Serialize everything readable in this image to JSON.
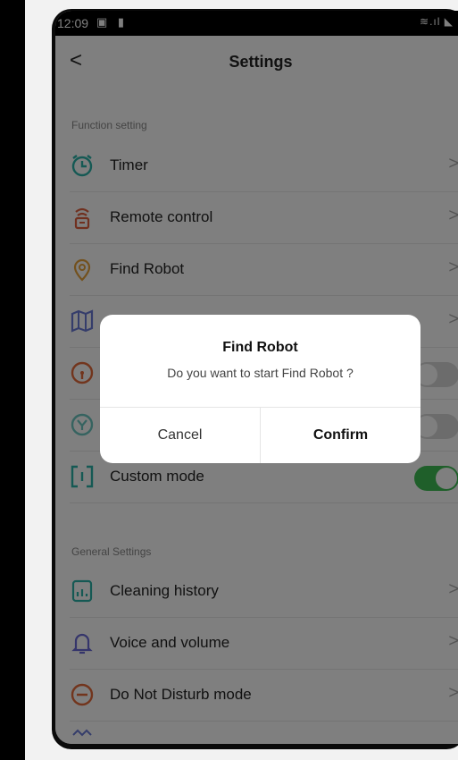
{
  "status_bar": {
    "time": "12:09",
    "left_icons": "▣ ▮",
    "signal": "≋.ıl ◣"
  },
  "header": {
    "back_glyph": "<",
    "title": "Settings"
  },
  "sections": {
    "function_label": "Function setting",
    "general_label": "General Settings"
  },
  "rows": {
    "timer": {
      "label": "Timer",
      "icon": "alarm-clock-icon",
      "color": "#2bb3a8"
    },
    "remote": {
      "label": "Remote control",
      "icon": "remote-control-icon",
      "color": "#e0603f"
    },
    "find": {
      "label": "Find Robot",
      "icon": "location-pin-icon",
      "color": "#e7a23a"
    },
    "map": {
      "label": "",
      "icon": "map-icon",
      "color": "#6b7bd6"
    },
    "row5": {
      "label": "",
      "icon": "gauge-icon",
      "color": "#e56b3b",
      "toggle": "off"
    },
    "row6": {
      "label": "",
      "icon": "filter-icon",
      "color": "#6cc7c1",
      "toggle": "off"
    },
    "custom": {
      "label": "Custom mode",
      "icon": "bracket-icon",
      "color": "#2bb3a8",
      "toggle": "on"
    },
    "history": {
      "label": "Cleaning history",
      "icon": "chart-doc-icon",
      "color": "#2bb3a8"
    },
    "voice": {
      "label": "Voice and volume",
      "icon": "bell-icon",
      "color": "#6b6bd6"
    },
    "dnd": {
      "label": "Do Not Disturb mode",
      "icon": "minus-circle-icon",
      "color": "#e56b3b"
    }
  },
  "chevron": ">",
  "dialog": {
    "title": "Find Robot",
    "message": "Do you want to start Find Robot ?",
    "cancel": "Cancel",
    "confirm": "Confirm"
  },
  "colors": {
    "toggle_on": "#3fbf55",
    "overlay": "rgba(0,0,0,0.5)"
  }
}
